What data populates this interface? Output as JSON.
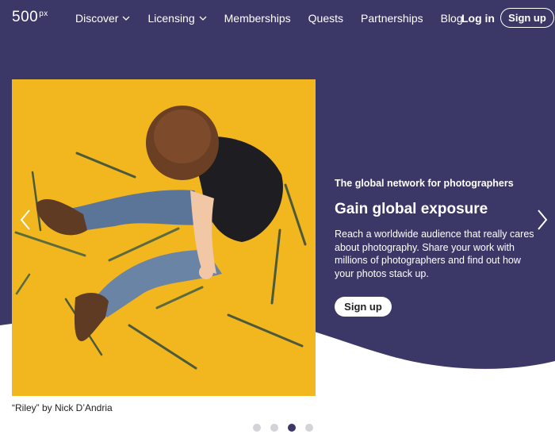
{
  "colors": {
    "hero_bg": "#3b3766",
    "photo_bg": "#f2b61f",
    "dot_active": "#3c3869",
    "dot_inactive": "#d3d3d8"
  },
  "nav": {
    "logo_main": "500",
    "logo_sup": "px",
    "items": [
      {
        "label": "Discover",
        "has_dropdown": true
      },
      {
        "label": "Licensing",
        "has_dropdown": true
      },
      {
        "label": "Memberships",
        "has_dropdown": false
      },
      {
        "label": "Quests",
        "has_dropdown": false
      },
      {
        "label": "Partnerships",
        "has_dropdown": false
      },
      {
        "label": "Blog",
        "has_dropdown": false
      }
    ],
    "login": "Log in",
    "signup": "Sign up"
  },
  "hero": {
    "tagline": "The global network for photographers",
    "headline": "Gain global exposure",
    "description": "Reach a worldwide audience that really cares about photography. Share your work with millions of photographers and find out how your photos stack up.",
    "signup": "Sign up",
    "caption": "“Riley” by Nick D’Andria"
  },
  "carousel": {
    "slide_count": 4,
    "active_index": 2,
    "prev_icon": "chevron-left-icon",
    "next_icon": "chevron-right-icon"
  }
}
